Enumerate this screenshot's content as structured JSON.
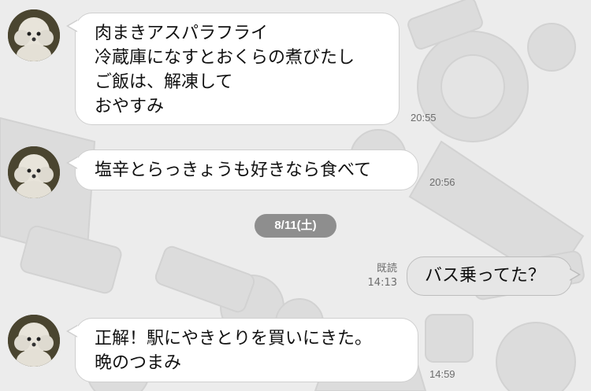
{
  "theme": {
    "background": "#ececec",
    "incoming_bubble": "#ffffff",
    "outgoing_bubble": "#e6e6e6",
    "date_pill": "#8e8e8e"
  },
  "messages": [
    {
      "direction": "incoming",
      "avatar_icon": "poodle-avatar-icon",
      "text": "肉まきアスパラフライ\n冷蔵庫になすとおくらの煮びたし\nご飯は、解凍して\nおやすみ",
      "time": "20:55"
    },
    {
      "direction": "incoming",
      "avatar_icon": "poodle-avatar-icon",
      "text": "塩辛とらっきょうも好きなら食べて",
      "time": "20:56"
    },
    {
      "direction": "incoming",
      "avatar_icon": "poodle-avatar-icon",
      "text": "正解！駅にやきとりを買いにきた。\n晩のつまみ",
      "time": "14:59"
    }
  ],
  "date_separator": "8/11(土)",
  "outgoing": {
    "text": "バス乗ってた？",
    "read_label": "既読",
    "time": "14:13"
  }
}
